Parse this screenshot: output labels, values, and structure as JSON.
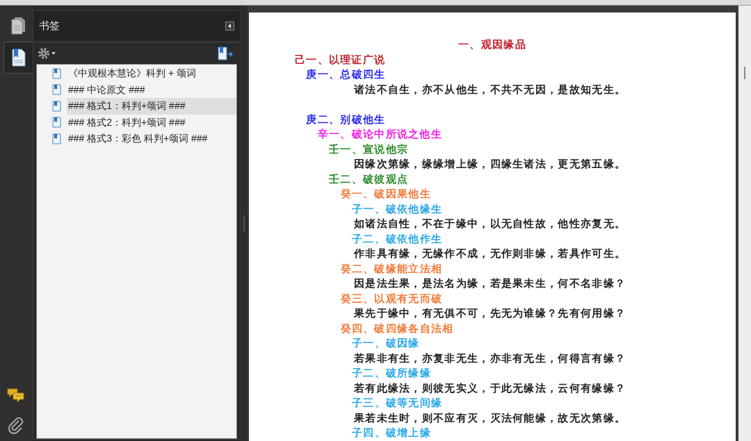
{
  "navigation_rail": {
    "tabs": [
      {
        "kind": "pages",
        "selected": false
      },
      {
        "kind": "bookmarks",
        "selected": true
      }
    ],
    "bottom_tools": [
      {
        "kind": "comments"
      },
      {
        "kind": "attachments"
      }
    ]
  },
  "bookmarks_panel": {
    "title": "书签",
    "items": [
      {
        "text": "《中观根本慧论》科判 + 颂词",
        "selected": false
      },
      {
        "text": "### 中论原文 ###",
        "selected": false
      },
      {
        "text": "### 格式1：科判+颂词 ###",
        "selected": true
      },
      {
        "text": "### 格式2：科判+颂词 ###",
        "selected": false
      },
      {
        "text": "### 格式3：彩色 科判+颂词 ###",
        "selected": false
      }
    ]
  },
  "document": {
    "title": "一、观因缘品",
    "outline": [
      {
        "kind": "heading",
        "text": "己一、以理证广说",
        "color": "#c0202a",
        "children": [
          {
            "kind": "heading",
            "text": "庚一、总破四生",
            "color": "#2b2bf0",
            "children": [
              {
                "kind": "verse",
                "text": "诸法不自生，亦不从他生，不共不无因，是故知无生。"
              },
              {
                "kind": "blank"
              }
            ]
          },
          {
            "kind": "heading",
            "text": "庚二、别破他生",
            "color": "#2b2bf0",
            "children": [
              {
                "kind": "heading",
                "text": "辛一、破论中所说之他生",
                "color": "#f020e8",
                "children": [
                  {
                    "kind": "heading",
                    "text": "壬一、宣说他宗",
                    "color": "#2a8a2a",
                    "children": [
                      {
                        "kind": "verse",
                        "text": "因缘次第缘，缘缘增上缘，四缘生诸法，更无第五缘。"
                      }
                    ]
                  },
                  {
                    "kind": "heading",
                    "text": "壬二、破彼观点",
                    "color": "#2a8a2a",
                    "children": [
                      {
                        "kind": "heading",
                        "text": "癸一、破因果他生",
                        "color": "#f07a3a",
                        "children": [
                          {
                            "kind": "heading",
                            "text": "子一、破依他缘生",
                            "color": "#28a8e8",
                            "children": [
                              {
                                "kind": "verse",
                                "text": "如诸法自性，不在于缘中，以无自性故，他性亦复无。"
                              }
                            ]
                          },
                          {
                            "kind": "heading",
                            "text": "子二、破依他作生",
                            "color": "#28a8e8",
                            "children": [
                              {
                                "kind": "verse",
                                "text": "作非具有缘，无缘作不成，无作则非缘，若具作可生。"
                              }
                            ]
                          }
                        ]
                      },
                      {
                        "kind": "heading",
                        "text": "癸二、破缘能立法相",
                        "color": "#f07a3a",
                        "children": [
                          {
                            "kind": "verse",
                            "text": "因是法生果，是法名为缘，若是果未生，何不名非缘？"
                          }
                        ]
                      },
                      {
                        "kind": "heading",
                        "text": "癸三、以观有无而破",
                        "color": "#f07a3a",
                        "children": [
                          {
                            "kind": "verse",
                            "text": "果先于缘中，有无俱不可，先无为谁缘？先有何用缘？"
                          }
                        ]
                      },
                      {
                        "kind": "heading",
                        "text": "癸四、破四缘各自法相",
                        "color": "#f07a3a",
                        "children": [
                          {
                            "kind": "heading",
                            "text": "子一、破因缘",
                            "color": "#28a8e8",
                            "children": [
                              {
                                "kind": "verse",
                                "text": "若果非有生，亦复非无生，亦非有无生，何得言有缘？"
                              }
                            ]
                          },
                          {
                            "kind": "heading",
                            "text": "子二、破所缘缘",
                            "color": "#28a8e8",
                            "children": [
                              {
                                "kind": "verse",
                                "text": "若有此缘法，则彼无实义，于此无缘法，云何有缘缘？"
                              }
                            ]
                          },
                          {
                            "kind": "heading",
                            "text": "子三、破等无间缘",
                            "color": "#28a8e8",
                            "children": [
                              {
                                "kind": "verse",
                                "text": "果若未生时，则不应有灭，灭法何能缘，故无次第缘。"
                              }
                            ]
                          },
                          {
                            "kind": "heading",
                            "text": "子四、破增上缘",
                            "color": "#28a8e8"
                          }
                        ]
                      }
                    ]
                  }
                ]
              }
            ]
          }
        ]
      }
    ]
  }
}
